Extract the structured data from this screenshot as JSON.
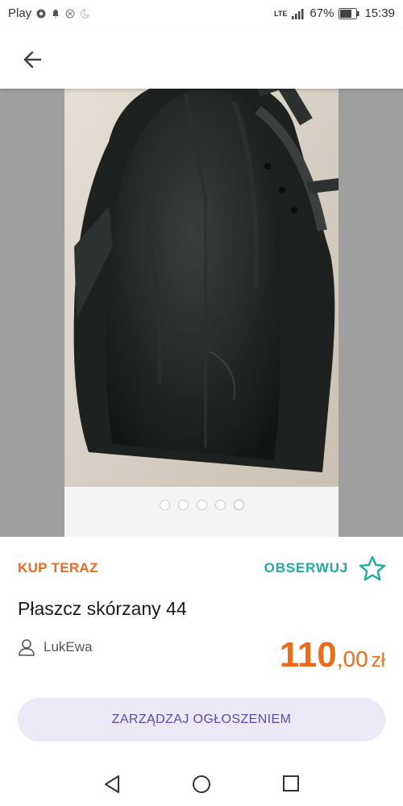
{
  "status_bar": {
    "carrier": "Play",
    "network": "LTE",
    "battery": "67%",
    "time": "15:39"
  },
  "app_bar": {
    "back_icon": "arrow-left-icon"
  },
  "gallery": {
    "image_count": 5,
    "active_index": 4,
    "subject": "black leather coat photo"
  },
  "listing": {
    "buy_label": "KUP TERAZ",
    "follow_label": "OBSERWUJ",
    "title": "Płaszcz skórzany 44",
    "seller": "LukEwa",
    "price_int": "110",
    "price_dec": ",00",
    "currency": "zł"
  },
  "actions": {
    "manage_label": "ZARZĄDZAJ OGŁOSZENIEM"
  },
  "colors": {
    "accent_orange": "#ec6c1b",
    "accent_teal": "#23a9a0",
    "button_bg": "#ece8f5",
    "button_text": "#5a4ea6"
  }
}
